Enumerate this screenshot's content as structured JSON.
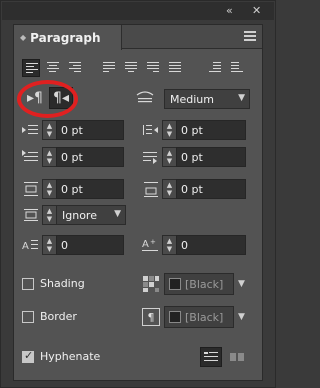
{
  "window": {
    "collapse_label": "«",
    "close_label": "✕"
  },
  "panel": {
    "tab_title": "Paragraph",
    "tab_arrows": "◆"
  },
  "alignment_buttons": [
    {
      "name": "align-left",
      "selected": true
    },
    {
      "name": "align-center",
      "selected": false
    },
    {
      "name": "align-right",
      "selected": false
    },
    {
      "name": "justify-last-left",
      "selected": false
    },
    {
      "name": "justify-last-center",
      "selected": false
    },
    {
      "name": "justify-last-right",
      "selected": false
    },
    {
      "name": "justify-all",
      "selected": false
    },
    {
      "name": "align-towards-spine",
      "selected": false
    },
    {
      "name": "align-away-from-spine",
      "selected": false
    }
  ],
  "direction": {
    "ltr_glyph": "▸¶",
    "rtl_glyph": "¶◂",
    "composer_value": "Medium",
    "highlight_color": "#e02020"
  },
  "indents": {
    "left_indent": "0 pt",
    "right_indent": "0 pt",
    "first_line_indent": "0 pt",
    "last_line_indent": "0 pt",
    "space_before": "0 pt",
    "space_after": "0 pt",
    "align_to_grid": "Ignore",
    "drop_cap_lines": "0",
    "drop_cap_chars": "0"
  },
  "shading": {
    "label": "Shading",
    "checked": false,
    "color_label": "[Black]"
  },
  "border": {
    "label": "Border",
    "checked": false,
    "color_label": "[Black]"
  },
  "hyphenate": {
    "label": "Hyphenate",
    "checked": true
  }
}
